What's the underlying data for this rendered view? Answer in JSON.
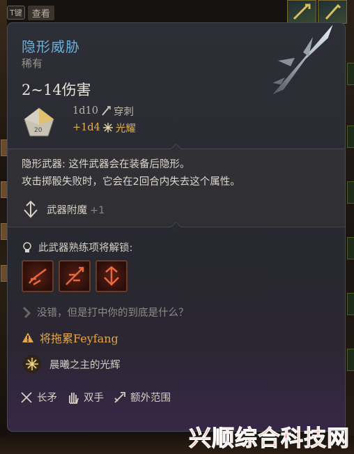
{
  "topbar": {
    "key_hint": "T键",
    "look_label": "查看"
  },
  "item": {
    "name": "隐形威胁",
    "rarity": "稀有",
    "damage_range": "2~14伤害",
    "damage": [
      {
        "dice": "1d10",
        "type": "穿刺",
        "icon": "piercing-icon",
        "color": "#b8b2a6"
      },
      {
        "dice": "+1d4",
        "type": "光耀",
        "icon": "radiant-icon",
        "color": "#e2b04a"
      }
    ],
    "description_line1": "隐形武器: 这件武器会在装备后隐形。",
    "description_line2": "攻击掷骰失败时，它会在2回合内失去这个属性。",
    "enchantment": {
      "label": "武器附魔",
      "value": "+1"
    },
    "proficiency_unlock": "此武器熟练项将解锁:",
    "skills": [
      "skill-slash-icon",
      "skill-rush-icon",
      "skill-pierce-icon"
    ],
    "flavor_text": "没错，但是打中你的到底是什么？",
    "warning": "将拖累Feyfang",
    "passive": "晨曦之主的光辉",
    "properties": [
      {
        "label": "长矛",
        "icon": "spear-icon"
      },
      {
        "label": "双手",
        "icon": "hand-icon"
      },
      {
        "label": "额外范围",
        "icon": "reach-icon"
      }
    ]
  },
  "watermark": "兴顺综合科技网",
  "colors": {
    "title": "#6ab0d8",
    "bonus": "#e2b04a",
    "warning": "#e6a640"
  }
}
